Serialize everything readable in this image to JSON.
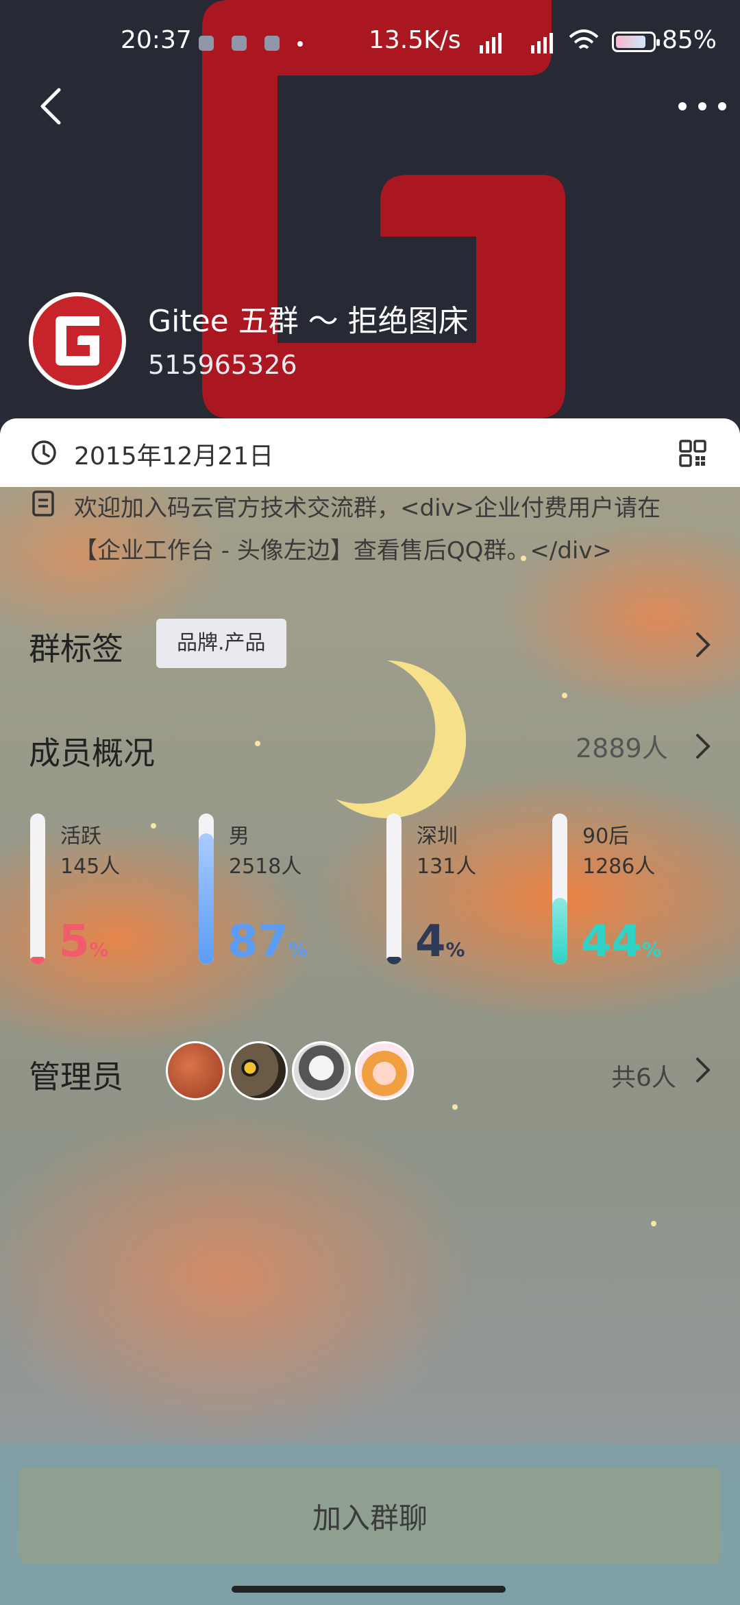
{
  "status_bar": {
    "time": "20:37",
    "net_speed": "13.5K/s",
    "battery": "85%",
    "battery_level": 0.85
  },
  "header": {
    "group_name": "Gitee 五群 ～ 拒绝图床",
    "group_id": "515965326",
    "brand_color": "#c7232b"
  },
  "info": {
    "created_date": "2015年12月21日",
    "intro": "欢迎加入码云官方技术交流群，<div>企业付费用户请在【企业工作台 - 头像左边】查看售后QQ群。</div>"
  },
  "tags": {
    "label": "群标签",
    "items": [
      "品牌.产品"
    ]
  },
  "members": {
    "label": "成员概况",
    "total": "2889人",
    "stats": [
      {
        "label": "活跃",
        "count": "145人",
        "percent": "5",
        "unit": "%",
        "fraction": 0.05,
        "color": "#f25a6e"
      },
      {
        "label": "男",
        "count": "2518人",
        "percent": "87",
        "unit": "%",
        "fraction": 0.87,
        "color": "#5b9cf5"
      },
      {
        "label": "深圳",
        "count": "131人",
        "percent": "4",
        "unit": "%",
        "fraction": 0.04,
        "color": "#2f3a56"
      },
      {
        "label": "90后",
        "count": "1286人",
        "percent": "44",
        "unit": "%",
        "fraction": 0.44,
        "color": "#2ed3c6"
      }
    ]
  },
  "admins": {
    "label": "管理员",
    "total": "共6人",
    "avatars": [
      "sweet-potato-avatar",
      "owl-avatar",
      "anime-boy-avatar",
      "cartoon-girl-avatar"
    ]
  },
  "join_button": "加入群聊"
}
